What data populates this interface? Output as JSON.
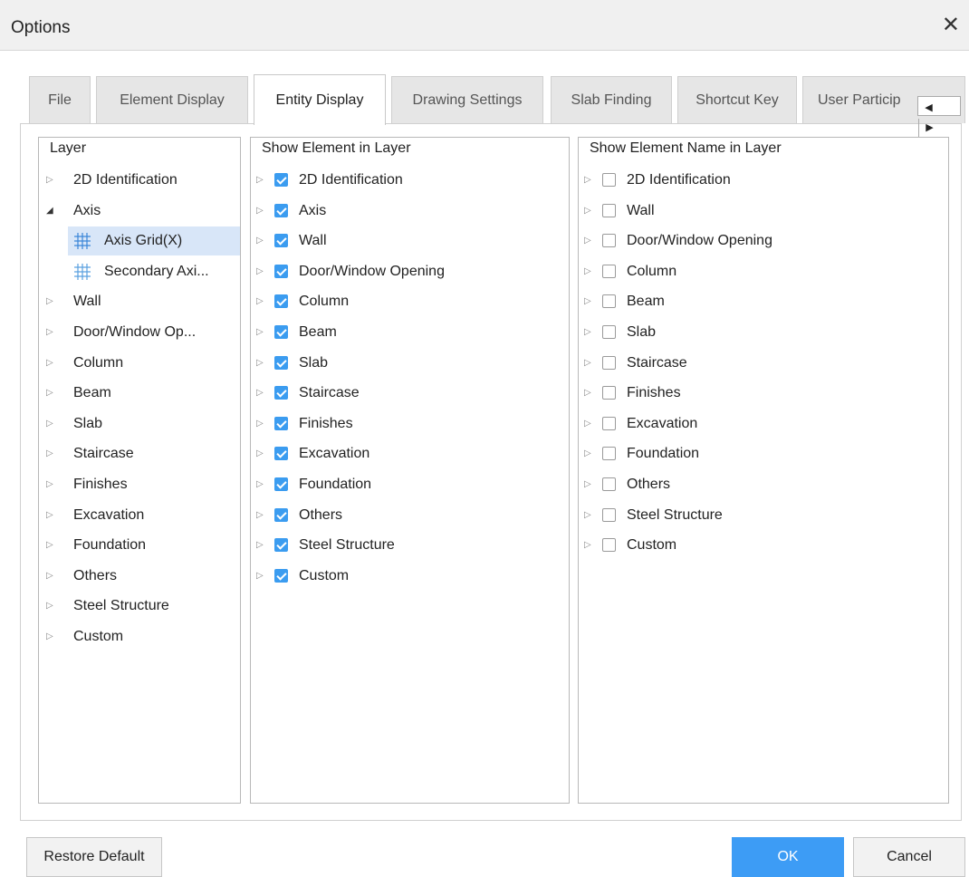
{
  "window": {
    "title": "Options",
    "close_glyph": "✕"
  },
  "tabs": [
    {
      "label": "File"
    },
    {
      "label": "Element Display"
    },
    {
      "label": "Entity Display",
      "active": true
    },
    {
      "label": "Drawing Settings"
    },
    {
      "label": "Slab Finding"
    },
    {
      "label": "Shortcut Key"
    },
    {
      "label": "User Particip"
    }
  ],
  "tab_scroll": {
    "left_glyph": "◀",
    "right_glyph": "▶"
  },
  "layer_panel": {
    "header": "Layer",
    "items": [
      {
        "label": "2D Identification",
        "level": 0,
        "expanded": false
      },
      {
        "label": "Axis",
        "level": 0,
        "expanded": true
      },
      {
        "label": "Axis Grid(X)",
        "level": 1,
        "icon": "axis-grid-icon",
        "selected": true
      },
      {
        "label": "Secondary Axi...",
        "level": 1,
        "icon": "secondary-axis-icon"
      },
      {
        "label": "Wall",
        "level": 0,
        "expanded": false
      },
      {
        "label": "Door/Window Op...",
        "level": 0,
        "expanded": false
      },
      {
        "label": "Column",
        "level": 0,
        "expanded": false
      },
      {
        "label": "Beam",
        "level": 0,
        "expanded": false
      },
      {
        "label": "Slab",
        "level": 0,
        "expanded": false
      },
      {
        "label": "Staircase",
        "level": 0,
        "expanded": false
      },
      {
        "label": "Finishes",
        "level": 0,
        "expanded": false
      },
      {
        "label": "Excavation",
        "level": 0,
        "expanded": false
      },
      {
        "label": "Foundation",
        "level": 0,
        "expanded": false
      },
      {
        "label": "Others",
        "level": 0,
        "expanded": false
      },
      {
        "label": "Steel Structure",
        "level": 0,
        "expanded": false
      },
      {
        "label": "Custom",
        "level": 0,
        "expanded": false
      }
    ]
  },
  "show_element_panel": {
    "header": "Show Element in Layer",
    "items": [
      {
        "label": "2D Identification",
        "checked": true
      },
      {
        "label": "Axis",
        "checked": true
      },
      {
        "label": "Wall",
        "checked": true
      },
      {
        "label": "Door/Window Opening",
        "checked": true
      },
      {
        "label": "Column",
        "checked": true
      },
      {
        "label": "Beam",
        "checked": true
      },
      {
        "label": "Slab",
        "checked": true
      },
      {
        "label": "Staircase",
        "checked": true
      },
      {
        "label": "Finishes",
        "checked": true
      },
      {
        "label": "Excavation",
        "checked": true
      },
      {
        "label": "Foundation",
        "checked": true
      },
      {
        "label": "Others",
        "checked": true
      },
      {
        "label": "Steel Structure",
        "checked": true
      },
      {
        "label": "Custom",
        "checked": true
      }
    ]
  },
  "show_name_panel": {
    "header": "Show Element Name in Layer",
    "items": [
      {
        "label": "2D Identification",
        "checked": false
      },
      {
        "label": "Wall",
        "checked": false
      },
      {
        "label": "Door/Window Opening",
        "checked": false
      },
      {
        "label": "Column",
        "checked": false
      },
      {
        "label": "Beam",
        "checked": false
      },
      {
        "label": "Slab",
        "checked": false
      },
      {
        "label": "Staircase",
        "checked": false
      },
      {
        "label": "Finishes",
        "checked": false
      },
      {
        "label": "Excavation",
        "checked": false
      },
      {
        "label": "Foundation",
        "checked": false
      },
      {
        "label": "Others",
        "checked": false
      },
      {
        "label": "Steel Structure",
        "checked": false
      },
      {
        "label": "Custom",
        "checked": false
      }
    ]
  },
  "buttons": {
    "restore_default": "Restore Default",
    "ok": "OK",
    "cancel": "Cancel"
  },
  "colors": {
    "accent": "#3d9cf5",
    "checkbox_checked": "#3b9cf0",
    "selected_row": "#d8e6f8",
    "tab_inactive": "#e6e6e6"
  }
}
